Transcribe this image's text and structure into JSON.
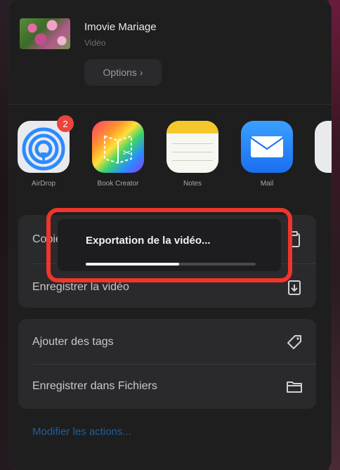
{
  "header": {
    "title": "Imovie Mariage",
    "subtitle": "Vidéo",
    "options_label": "Options",
    "options_chevron": "›"
  },
  "apps": [
    {
      "label": "AirDrop",
      "icon": "airdrop-icon",
      "badge": "2"
    },
    {
      "label": "Book Creator",
      "icon": "book-creator-icon"
    },
    {
      "label": "Notes",
      "icon": "notes-icon"
    },
    {
      "label": "Mail",
      "icon": "mail-icon"
    },
    {
      "label": "",
      "icon": "more-apps-icon"
    }
  ],
  "actions": {
    "copy": "Copier",
    "save_video": "Enregistrer la vidéo",
    "add_tags": "Ajouter des tags",
    "save_files": "Enregistrer dans Fichiers"
  },
  "modify_actions": "Modifier les actions...",
  "export": {
    "message": "Exportation de la vidéo...",
    "progress": 0.55
  },
  "colors": {
    "highlight": "#f0352b",
    "link": "#1f5f9a",
    "badge": "#e8453c"
  }
}
